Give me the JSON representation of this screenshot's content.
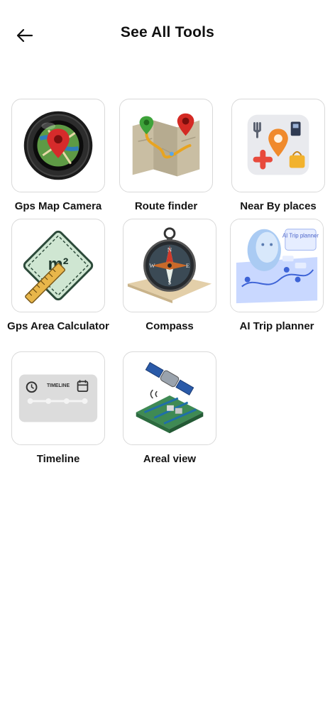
{
  "header": {
    "title": "See All Tools",
    "back_icon": "arrow-left-icon"
  },
  "tools": [
    {
      "label": "Gps Map Camera",
      "icon": "camera-lens-map-pin-icon"
    },
    {
      "label": "Route finder",
      "icon": "folded-map-route-icon"
    },
    {
      "label": "Near By places",
      "icon": "nearby-places-icon"
    },
    {
      "label": "Gps Area Calculator",
      "icon": "area-square-meter-icon"
    },
    {
      "label": "Compass",
      "icon": "compass-icon"
    },
    {
      "label": "AI Trip planner",
      "icon": "ai-trip-planner-icon"
    },
    {
      "label": "Timeline",
      "icon": "timeline-icon"
    },
    {
      "label": "Areal view",
      "icon": "satellite-aerial-view-icon"
    }
  ],
  "art_text": {
    "area_unit": "m²",
    "ai_trip": "AI Trip planner",
    "timeline": "TIMELINE",
    "compass_n": "N",
    "compass_s": "S",
    "compass_e": "E",
    "compass_w": "W"
  },
  "colors": {
    "background": "#ffffff",
    "tile_border": "#d9d9d9",
    "text": "#151515"
  }
}
